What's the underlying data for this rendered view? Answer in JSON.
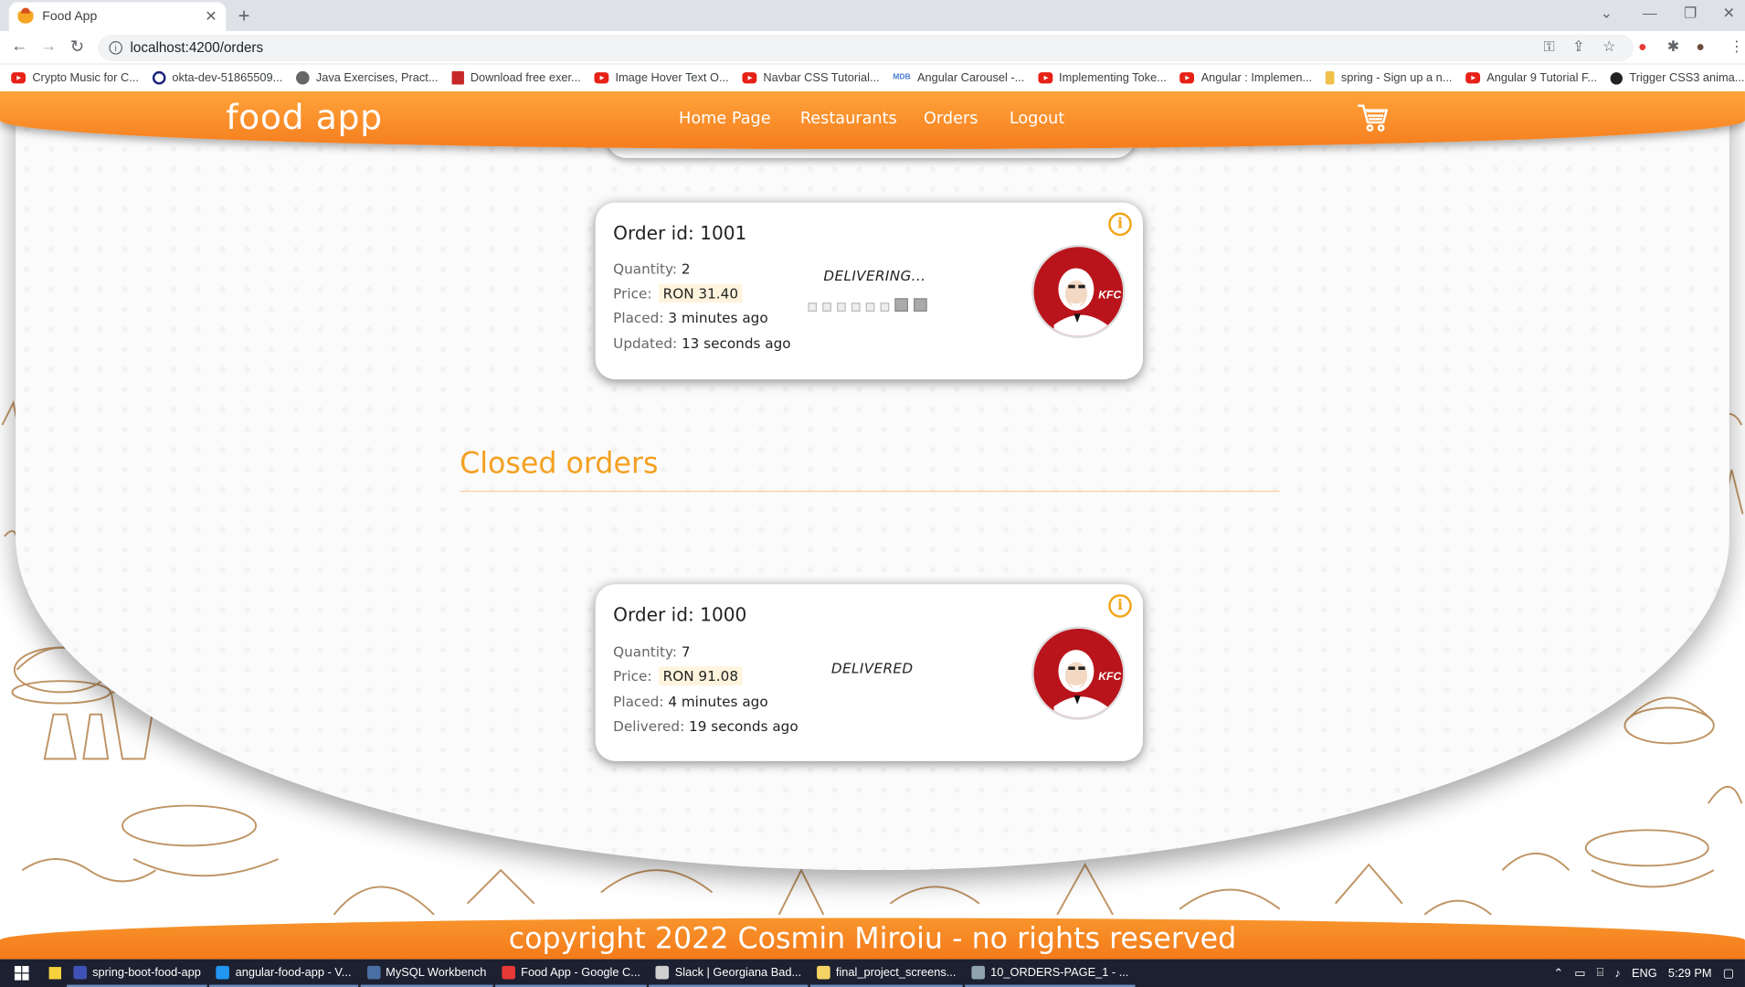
{
  "browser": {
    "tab_title": "Food App",
    "url": "localhost:4200/orders",
    "bookmarks": [
      {
        "label": "Crypto Music for C...",
        "icon": "yt"
      },
      {
        "label": "okta-dev-51865509...",
        "icon": "circle"
      },
      {
        "label": "Java Exercises, Pract...",
        "icon": "gear"
      },
      {
        "label": "Download free exer...",
        "icon": "doc"
      },
      {
        "label": "Image Hover Text O...",
        "icon": "yt"
      },
      {
        "label": "Navbar CSS Tutorial...",
        "icon": "yt"
      },
      {
        "label": "Angular Carousel -...",
        "icon": "mdb"
      },
      {
        "label": "Implementing Toke...",
        "icon": "yt"
      },
      {
        "label": "Angular : Implemen...",
        "icon": "yt"
      },
      {
        "label": "spring - Sign up a n...",
        "icon": "spring"
      },
      {
        "label": "Angular 9 Tutorial F...",
        "icon": "yt"
      },
      {
        "label": "Trigger CSS3 anima...",
        "icon": "gh"
      }
    ],
    "bookmark_mdb_text": "MDB"
  },
  "navbar": {
    "brand": "food app",
    "links": [
      "Home Page",
      "Restaurants",
      "Orders",
      "Logout"
    ]
  },
  "active_order": {
    "title": "Order id: 1001",
    "quantity_label": "Quantity:",
    "quantity": "2",
    "price_label": "Price:",
    "price": "RON 31.40",
    "placed_label": "Placed:",
    "placed": "3 minutes ago",
    "updated_label": "Updated:",
    "updated": "13 seconds ago",
    "status": "DELIVERING..."
  },
  "closed_section_title": "Closed orders",
  "closed_order": {
    "title": "Order id: 1000",
    "quantity_label": "Quantity:",
    "quantity": "7",
    "price_label": "Price:",
    "price": "RON 91.08",
    "placed_label": "Placed:",
    "placed": "4 minutes ago",
    "delivered_label": "Delivered:",
    "delivered": "19 seconds ago",
    "status": "DELIVERED"
  },
  "logo_text": "KFC",
  "footer": "copyright 2022 Cosmin Miroiu - no rights reserved",
  "taskbar": {
    "apps": [
      {
        "label": "spring-boot-food-app",
        "color": "#3f51b5"
      },
      {
        "label": "angular-food-app - V...",
        "color": "#2196f3"
      },
      {
        "label": "MySQL Workbench",
        "color": "#4a6fa5"
      },
      {
        "label": "Food App - Google C...",
        "color": "#e53935"
      },
      {
        "label": "Slack | Georgiana Bad...",
        "color": "#cfcfcf"
      },
      {
        "label": "final_project_screens...",
        "color": "#f6d365"
      },
      {
        "label": "10_ORDERS-PAGE_1 - ...",
        "color": "#90a4ae"
      }
    ],
    "lang": "ENG",
    "time": "5:29 PM"
  },
  "colors": {
    "accent": "#f57d1e",
    "title_orange": "#f4a020",
    "info_icon": "#f2a519"
  }
}
